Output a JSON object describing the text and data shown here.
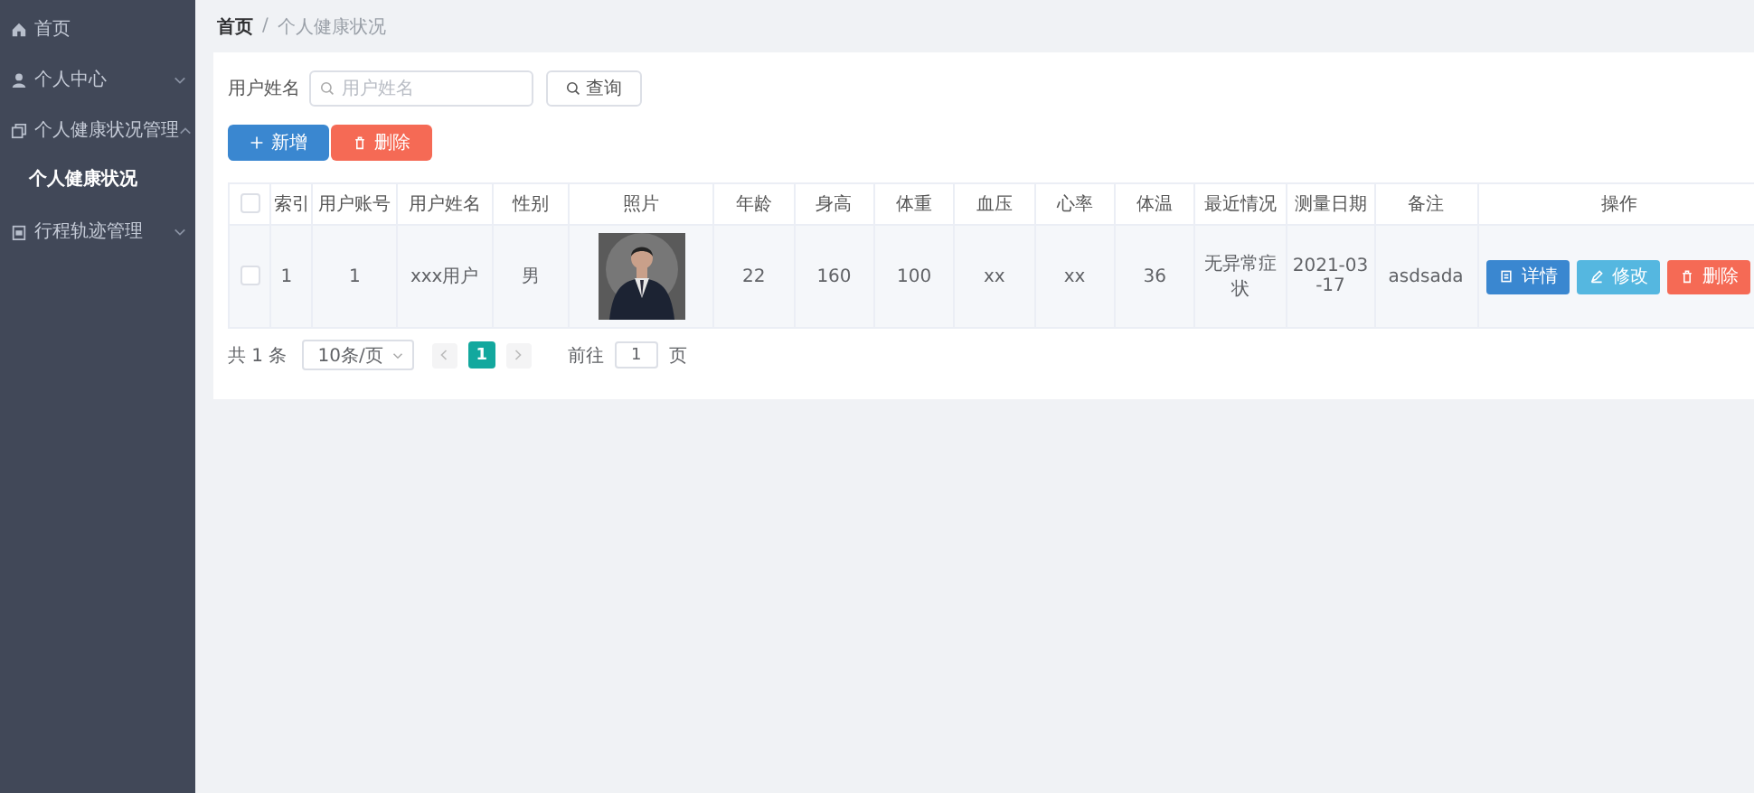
{
  "sidebar": {
    "items": [
      {
        "label": "首页"
      },
      {
        "label": "个人中心",
        "expanded": false
      },
      {
        "label": "个人健康状况管理",
        "expanded": true,
        "children": [
          {
            "label": "个人健康状况",
            "selected": true
          }
        ]
      },
      {
        "label": "行程轨迹管理",
        "expanded": false
      }
    ]
  },
  "breadcrumb": {
    "separator": "/",
    "items": [
      "首页",
      "个人健康状况"
    ]
  },
  "search": {
    "label": "用户姓名",
    "placeholder": "用户姓名",
    "button": "查询"
  },
  "actions": [
    {
      "label": "新增",
      "kind": "add"
    },
    {
      "label": "删除",
      "kind": "delete"
    }
  ],
  "table": {
    "select_all_checked": false,
    "columns": [
      "索引",
      "用户账号",
      "用户姓名",
      "性别",
      "照片",
      "年龄",
      "身高",
      "体重",
      "血压",
      "心率",
      "体温",
      "最近情况",
      "测量日期",
      "备注",
      "操作"
    ],
    "rows": [
      {
        "checked": false,
        "cells": [
          "1",
          "1",
          "xxx用户",
          "男",
          {
            "kind": "picture"
          },
          "22",
          "160",
          "100",
          "xx",
          "xx",
          "36",
          "无异常症状",
          "2021-03-17",
          "asdsada"
        ],
        "buttons": [
          {
            "label": "详情",
            "kind": "detail"
          },
          {
            "label": "修改",
            "kind": "edit"
          },
          {
            "label": "删除",
            "kind": "delete"
          }
        ]
      }
    ]
  },
  "pagination": {
    "total": "共 1 条",
    "page_size": "10条/页",
    "pages": [
      {
        "label": "1",
        "selected": true
      }
    ],
    "goto_label": "前往",
    "goto_value": "1",
    "goto_suffix": "页"
  }
}
